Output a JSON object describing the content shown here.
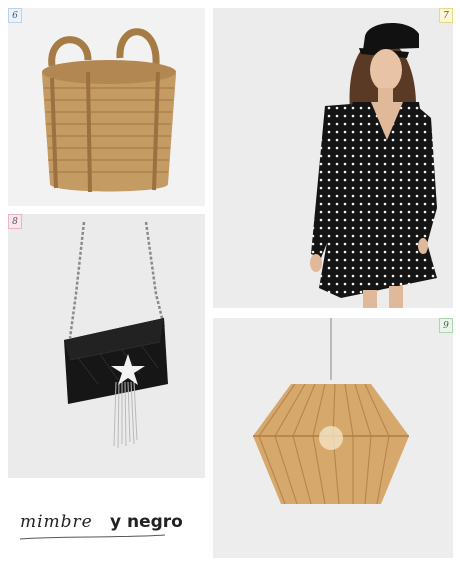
{
  "products": [
    {
      "number": "6",
      "name": "basket-image",
      "color": "#c29a63"
    },
    {
      "number": "7",
      "name": "dress-image",
      "color": "#141414"
    },
    {
      "number": "8",
      "name": "bag-image",
      "color": "#161616"
    },
    {
      "number": "9",
      "name": "lamp-image",
      "color": "#c7955a"
    }
  ],
  "caption": {
    "script_word": "mimbre",
    "bold_word": "y negro"
  }
}
